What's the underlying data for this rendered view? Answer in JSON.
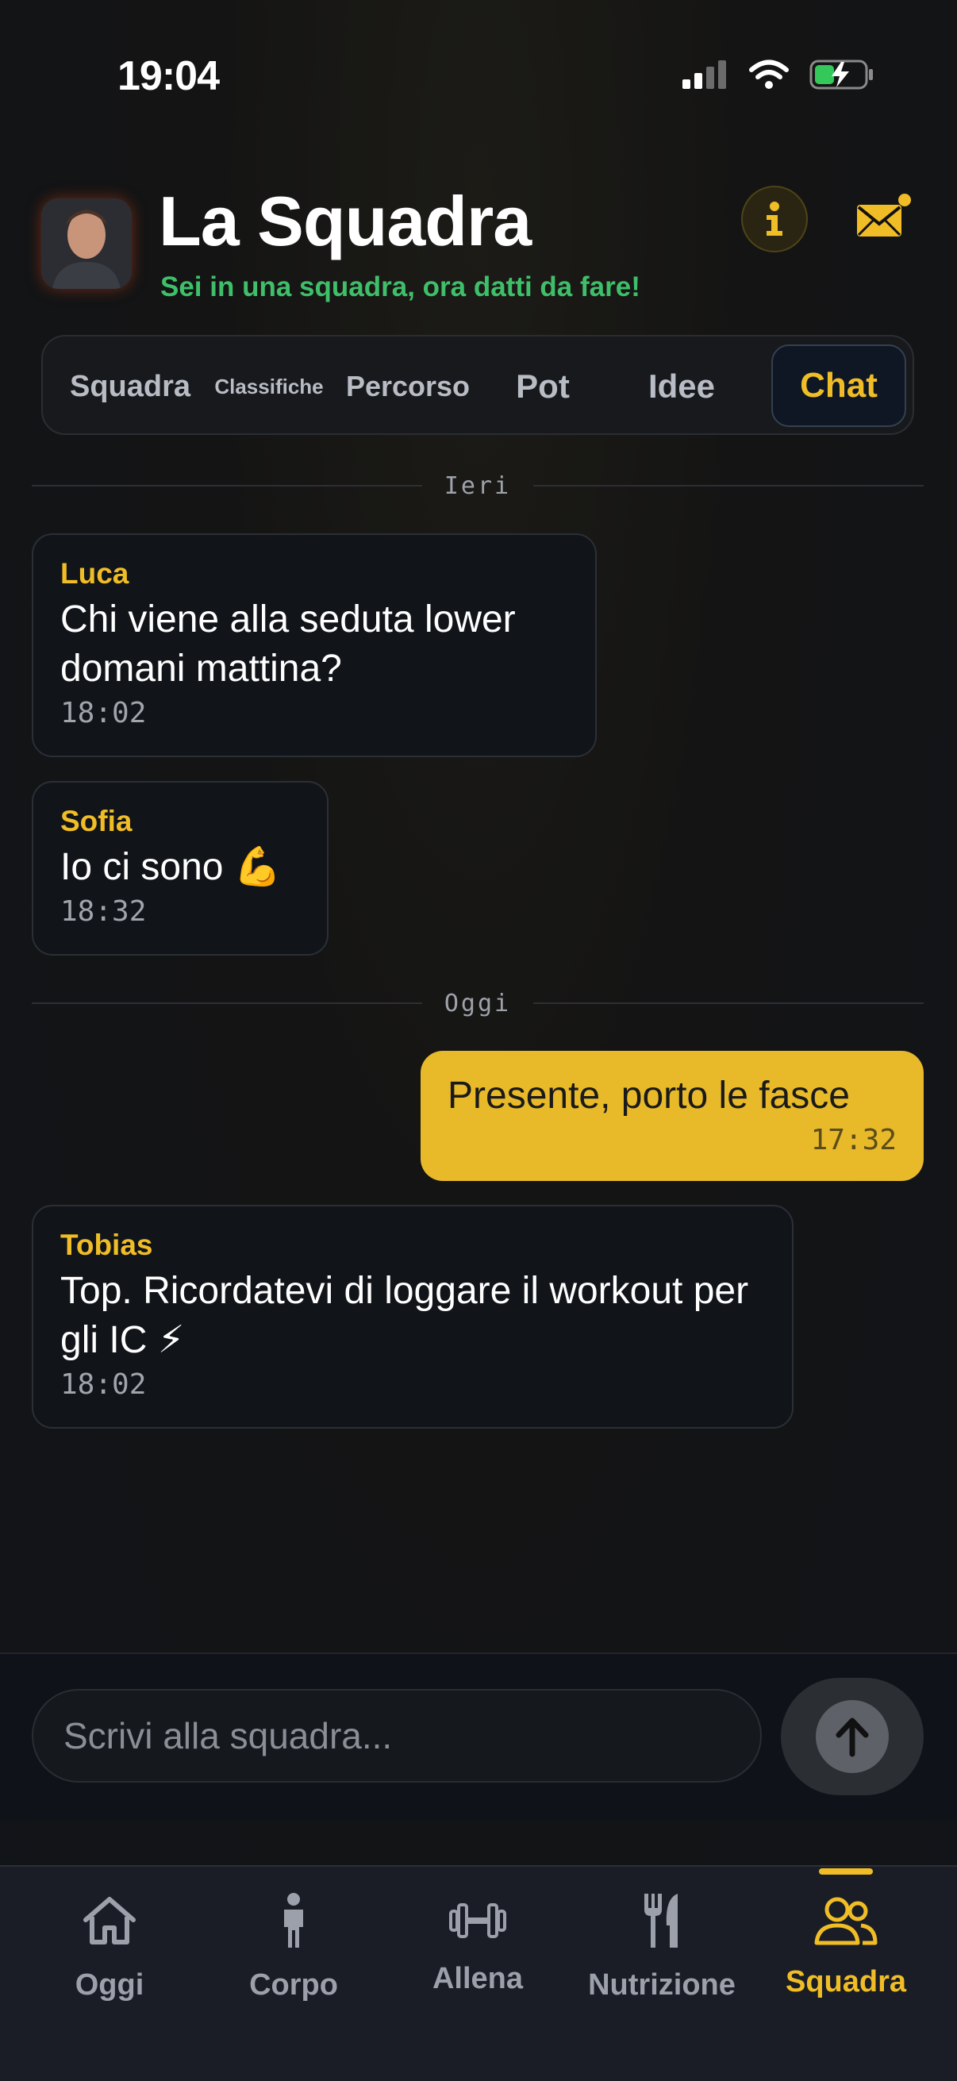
{
  "status_bar": {
    "time": "19:04"
  },
  "header": {
    "title": "La Squadra",
    "subtitle": "Sei in una squadra, ora datti da fare!",
    "info_icon": "info-icon",
    "mail_icon": "mail-icon"
  },
  "tabs": [
    {
      "label": "Squadra",
      "active": false
    },
    {
      "label": "Classifiche",
      "active": false
    },
    {
      "label": "Percorso",
      "active": false
    },
    {
      "label": "Pot",
      "active": false
    },
    {
      "label": "Idee",
      "active": false
    },
    {
      "label": "Chat",
      "active": true
    }
  ],
  "chat": {
    "dividers": [
      "Ieri",
      "Oggi"
    ],
    "messages": [
      {
        "author": "Luca",
        "text": "Chi viene alla seduta lower domani mattina?",
        "time": "18:02",
        "mine": false
      },
      {
        "author": "Sofia",
        "text": "Io ci sono 💪",
        "time": "18:32",
        "mine": false
      },
      {
        "author": "",
        "text": "Presente, porto le fasce",
        "time": "17:32",
        "mine": true
      },
      {
        "author": "Tobias",
        "text": "Top. Ricordatevi di loggare il workout per gli IC ⚡",
        "time": "18:02",
        "mine": false
      }
    ]
  },
  "composer": {
    "placeholder": "Scrivi alla squadra..."
  },
  "nav": [
    {
      "label": "Oggi",
      "icon": "home-icon"
    },
    {
      "label": "Corpo",
      "icon": "person-icon"
    },
    {
      "label": "Allena",
      "icon": "dumbbell-icon"
    },
    {
      "label": "Nutrizione",
      "icon": "fork-knife-icon"
    },
    {
      "label": "Squadra",
      "icon": "team-icon",
      "active": true
    }
  ],
  "colors": {
    "accent": "#f0bd27",
    "subtitle_green": "#3fbf6a",
    "bubble_mine": "#e8b929"
  }
}
